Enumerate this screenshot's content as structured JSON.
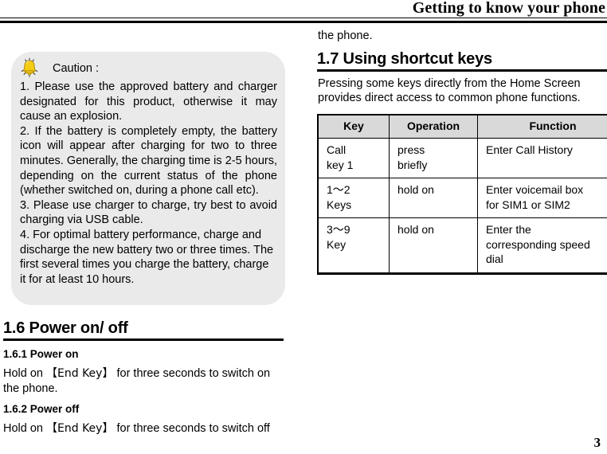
{
  "header": {
    "title": "Getting to know your phone"
  },
  "left_column": {
    "caution": {
      "icon": "bell-icon",
      "label": "Caution :",
      "items": [
        "1. Please use the approved battery and charger designated for this product, otherwise it may cause an explosion.",
        "2. If the battery is completely empty, the battery icon will appear after charging for two to three minutes. Generally, the charging time is 2-5 hours, depending on the current status of the phone (whether switched on, during a phone call etc).",
        "3. Please use charger to charge, try best to avoid charging via USB cable.",
        "4. For optimal battery performance, charge and discharge the new battery two or three times. The first several times you charge the battery, charge it for at least 10 hours."
      ]
    },
    "section": {
      "heading": "1.6 Power on/ off",
      "sub1": {
        "heading": "1.6.1 Power on",
        "text_before": "Hold on ",
        "key": "【End Key】",
        "text_after": " for three seconds to switch on the phone."
      },
      "sub2": {
        "heading": "1.6.2 Power off",
        "text_before": "Hold on ",
        "key": "【End Key】",
        "text_after": " for three seconds to switch off"
      }
    }
  },
  "right_column": {
    "continuation": "the phone.",
    "section": {
      "heading": "1.7 Using shortcut keys",
      "intro": "Pressing some keys directly from the Home Screen provides direct access to common phone functions."
    },
    "table": {
      "columns": [
        "Key",
        "Operation",
        "Function"
      ],
      "rows": [
        {
          "key": [
            "Call",
            "key 1"
          ],
          "operation": [
            "press",
            "briefly"
          ],
          "function": [
            "Enter Call History"
          ]
        },
        {
          "key": [
            "1～2",
            "Keys"
          ],
          "operation": [
            "hold on"
          ],
          "function": [
            "Enter voicemail box",
            "for SIM1 or SIM2"
          ]
        },
        {
          "key": [
            "3～9",
            "Key"
          ],
          "operation": [
            "hold on"
          ],
          "function": [
            "Enter the",
            "corresponding speed",
            "dial"
          ]
        }
      ]
    }
  },
  "footer": {
    "page_number": "3"
  },
  "colors": {
    "caution_bg": "#eaeaea",
    "table_header_bg": "#d9d9d9",
    "bell_yellow": "#f5cc14",
    "rule": "#000000"
  }
}
